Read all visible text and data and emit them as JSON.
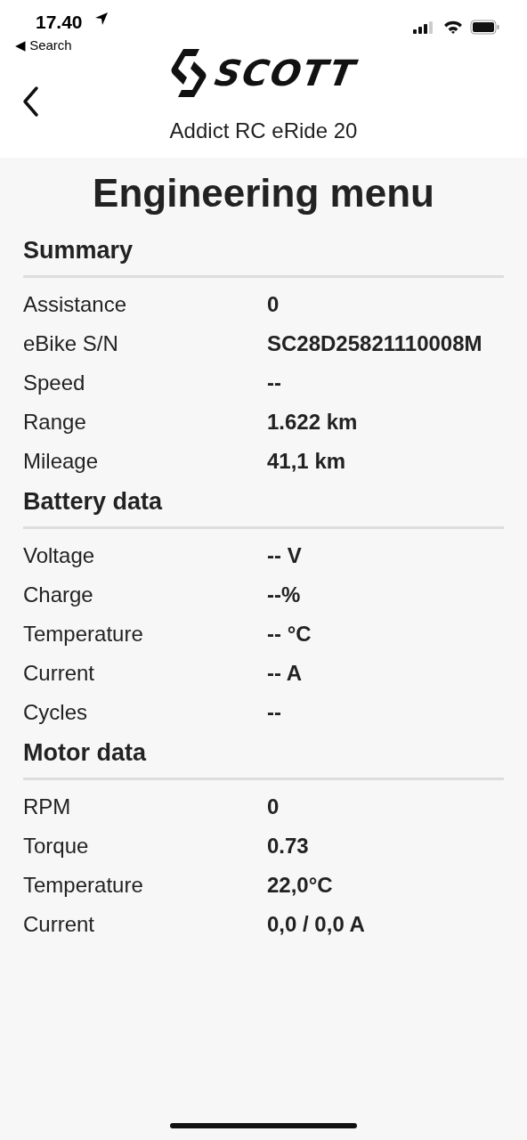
{
  "status_bar": {
    "time": "17.40",
    "back_label": "◀ Search"
  },
  "header": {
    "logo_text": "SCOTT",
    "subtitle": "Addict RC eRide 20"
  },
  "title": "Engineering menu",
  "sections": [
    {
      "heading": "Summary",
      "rows": [
        {
          "label": "Assistance",
          "value": "0"
        },
        {
          "label": "eBike S/N",
          "value": "SC28D25821110008M"
        },
        {
          "label": "Speed",
          "value": "--"
        },
        {
          "label": "Range",
          "value": "1.622 km"
        },
        {
          "label": "Mileage",
          "value": "41,1 km"
        }
      ]
    },
    {
      "heading": "Battery data",
      "rows": [
        {
          "label": "Voltage",
          "value": "-- V"
        },
        {
          "label": "Charge",
          "value": "--%"
        },
        {
          "label": "Temperature",
          "value": "-- °C"
        },
        {
          "label": "Current",
          "value": "-- A"
        },
        {
          "label": "Cycles",
          "value": "--"
        }
      ]
    },
    {
      "heading": "Motor data",
      "rows": [
        {
          "label": "RPM",
          "value": "0"
        },
        {
          "label": "Torque",
          "value": "0.73"
        },
        {
          "label": "Temperature",
          "value": "22,0°C"
        },
        {
          "label": "Current",
          "value": "0,0 / 0,0 A"
        }
      ]
    }
  ]
}
